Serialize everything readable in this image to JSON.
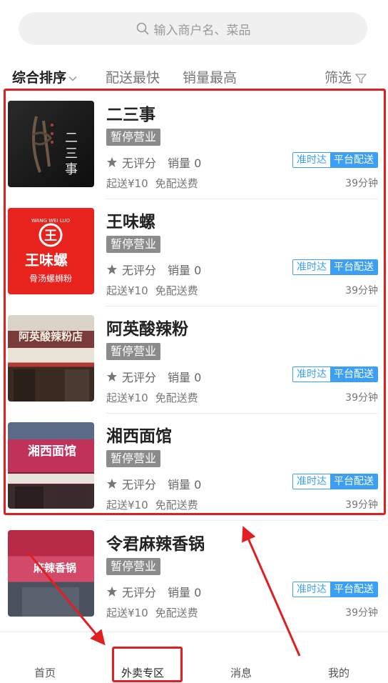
{
  "search": {
    "placeholder": "输入商户名、菜品",
    "icon": "search-icon"
  },
  "filters": {
    "sort_label": "综合排序",
    "fastest_label": "配送最快",
    "sales_label": "销量最高",
    "filter_label": "筛选"
  },
  "shops": [
    {
      "name": "二三事",
      "status": "暂停营业",
      "rating": "无评分",
      "sales": "销量 0",
      "tag_ontime": "准时达",
      "tag_platform": "平台配送",
      "min_order": "起送¥10",
      "delivery_fee": "免配送费",
      "eta": "39分钟",
      "logo_text": "二三事"
    },
    {
      "name": "王味螺",
      "status": "暂停营业",
      "rating": "无评分",
      "sales": "销量 0",
      "tag_ontime": "准时达",
      "tag_platform": "平台配送",
      "min_order": "起送¥10",
      "delivery_fee": "免配送费",
      "eta": "39分钟",
      "logo_text": "王味螺",
      "logo_sub": "骨汤螺蛳粉",
      "logo_top": "WANG WEI LUO",
      "logo_mark": "王"
    },
    {
      "name": "阿英酸辣粉",
      "status": "暂停营业",
      "rating": "无评分",
      "sales": "销量 0",
      "tag_ontime": "准时达",
      "tag_platform": "平台配送",
      "min_order": "起送¥10",
      "delivery_fee": "免配送费",
      "eta": "39分钟",
      "logo_text": "阿英酸辣粉店"
    },
    {
      "name": "湘西面馆",
      "status": "暂停营业",
      "rating": "无评分",
      "sales": "销量 0",
      "tag_ontime": "准时达",
      "tag_platform": "平台配送",
      "min_order": "起送¥10",
      "delivery_fee": "免配送费",
      "eta": "39分钟",
      "logo_text": "湘西面馆"
    },
    {
      "name": "令君麻辣香锅",
      "status": "暂停营业",
      "rating": "无评分",
      "sales": "销量 0",
      "tag_ontime": "准时达",
      "tag_platform": "平台配送",
      "min_order": "起送¥10",
      "delivery_fee": "免配送费",
      "eta": "39分钟",
      "logo_text": "麻辣香锅"
    }
  ],
  "nav": {
    "home": "首页",
    "takeout": "外卖专区",
    "messages": "消息",
    "mine": "我的"
  },
  "colors": {
    "accent_blue": "#3a9ff5",
    "status_gray": "#8b8b8b",
    "highlight_red": "#e02020"
  }
}
